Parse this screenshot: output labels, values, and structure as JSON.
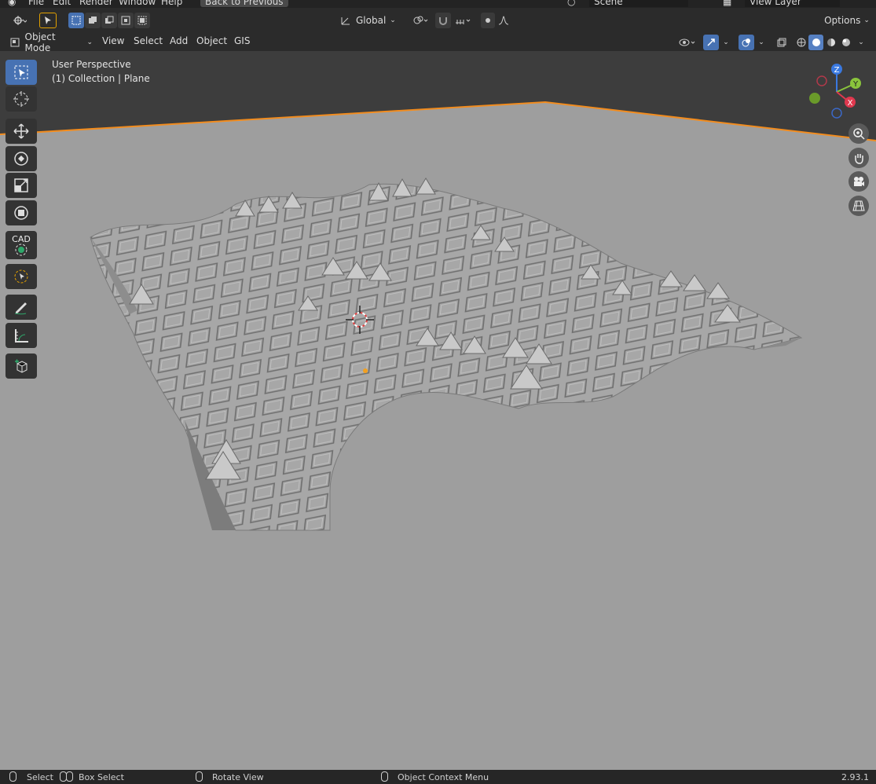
{
  "menubar": {
    "items": [
      "File",
      "Edit",
      "Render",
      "Window",
      "Help"
    ],
    "back_button": "Back to Previous",
    "scene": "Scene",
    "view_layer": "View Layer"
  },
  "header": {
    "transform_orientation": "Global",
    "options_label": "Options"
  },
  "header2": {
    "mode": "Object Mode",
    "menus": [
      "View",
      "Select",
      "Add",
      "Object",
      "GIS"
    ]
  },
  "viewport": {
    "overlay_line1": "User Perspective",
    "overlay_line2": "(1) Collection | Plane",
    "gizmo": {
      "z": "Z",
      "y": "Y",
      "x": "X"
    }
  },
  "toolbar": {
    "cad_label": "CAD"
  },
  "status": {
    "select": "Select",
    "box_select": "Box Select",
    "rotate_view": "Rotate View",
    "context_menu": "Object Context Menu",
    "version": "2.93.1"
  }
}
